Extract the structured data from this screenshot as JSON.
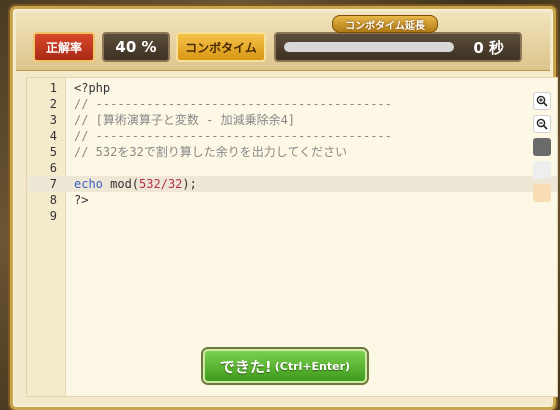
{
  "header": {
    "correct_rate_label": "正解率",
    "correct_rate_value": "40 %",
    "combo_time_label": "コンボタイム",
    "combo_extension_label": "コンボタイム延長",
    "combo_seconds": "0 秒",
    "combo_gauge_fraction": 0.0
  },
  "editor": {
    "line_numbers": [
      "1",
      "2",
      "3",
      "4",
      "5",
      "6",
      "7",
      "8",
      "9"
    ],
    "lines": [
      "<?php",
      "// -----------------------------------------",
      "// [算術演算子と変数 - 加減乗除余4]",
      "// -----------------------------------------",
      "// 532を32で割り算した余りを出力してください",
      "",
      "",
      "?>",
      ""
    ],
    "line7": {
      "keyword": "echo",
      "func": " mod(",
      "num1": "532",
      "slash": "/",
      "num2": "32",
      "tail": ");"
    },
    "active_line": 7
  },
  "tools": {
    "zoom_in": "+",
    "zoom_out": "-",
    "colors": [
      "#6a6a6a",
      "#eeeeee",
      "#f7dcb4"
    ]
  },
  "submit": {
    "main_label": "できた!",
    "shortcut_label": "(Ctrl+Enter)"
  }
}
